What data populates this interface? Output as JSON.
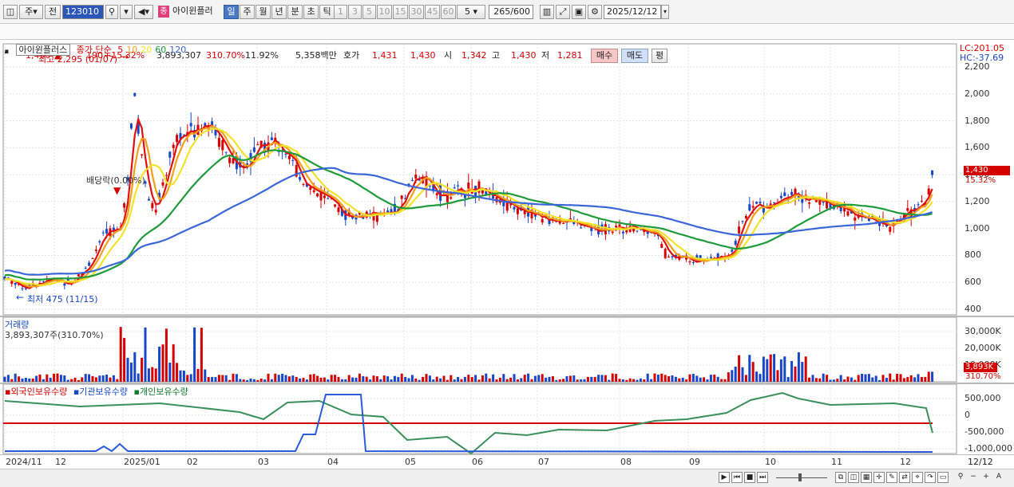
{
  "toolbar": {
    "type_label": "주",
    "prev_label": "전",
    "code": "123010",
    "name_badge": "종",
    "stock_name": "아이윈플러",
    "periods": [
      "일",
      "주",
      "월",
      "년",
      "분",
      "초",
      "틱"
    ],
    "selected_period": "일",
    "minutes": [
      "1",
      "3",
      "5",
      "10",
      "15",
      "30",
      "45",
      "60"
    ],
    "minute_value": "5",
    "count": "265",
    "count_max": "/600",
    "date": "2025/12/12"
  },
  "quote": {
    "price": "1,430",
    "change": "190",
    "change_pct": "+15.32%",
    "volume": "3,893,307",
    "vol_ratio": "310.70%",
    "turnover": "11.92%",
    "amount": "5,358백만",
    "hoga_label": "호가",
    "ask": "1,431",
    "bid": "1,430",
    "open_label": "시",
    "open": "1,342",
    "high_label": "고",
    "high": "1,430",
    "low_label": "저",
    "low": "1,281",
    "buy_label": "매수",
    "sell_label": "매도",
    "avg_label": "평"
  },
  "price_panel": {
    "stock_label": "아이윈플러스",
    "legend_prefix": "종가 단순",
    "ma": [
      {
        "period": "5",
        "color": "#e01010"
      },
      {
        "period": "10",
        "color": "#f2a01a"
      },
      {
        "period": "20",
        "color": "#f2e22a"
      },
      {
        "period": "60",
        "color": "#1e9a3a"
      },
      {
        "period": "120",
        "color": "#3a66d8"
      }
    ],
    "high_note": "최고 2,295 (01/07)",
    "low_note": "최저 475 (11/15)",
    "dividend_note": "배당락(0.00%)",
    "lc": "LC:201.05",
    "hc": "HC:-37.69",
    "y_ticks": [
      "2,200",
      "2,000",
      "1,800",
      "1,600",
      "1,400",
      "1,200",
      "1,000",
      "800",
      "600",
      "400"
    ],
    "current_price": "1,430",
    "current_pct": "15.32%"
  },
  "volume_panel": {
    "title": "거래량",
    "value": "3,893,307주(310.70%)",
    "y_ticks": [
      "30,000K",
      "20,000K",
      "10,000K"
    ],
    "current": "3,893K",
    "current_pct": "310.70%"
  },
  "holding_panel": {
    "series": [
      "외국인보유수량",
      "기관보유수량",
      "개인보유수량"
    ],
    "y_ticks": [
      "500,000",
      "0",
      "-500,000",
      "-1,000,000"
    ]
  },
  "x_axis": [
    "2024/11",
    "12",
    "2025/01",
    "02",
    "03",
    "04",
    "05",
    "06",
    "07",
    "08",
    "09",
    "10",
    "11",
    "12"
  ],
  "x_axis_right": "12/12",
  "colors": {
    "up": "#d40000",
    "down": "#1747c9",
    "highlight": "#4a78c2"
  },
  "chart_data": {
    "type": "line",
    "title": "",
    "ylim": [
      400,
      2300
    ],
    "x": [
      "2024/11",
      "12",
      "2025/01",
      "02",
      "03",
      "04",
      "05",
      "06",
      "07",
      "08",
      "09",
      "10",
      "11",
      "12/12"
    ],
    "series": [
      {
        "name": "5",
        "values": [
          560,
          720,
          1600,
          1800,
          1650,
          1150,
          1300,
          1250,
          1050,
          1000,
          800,
          1200,
          1100,
          1400
        ]
      },
      {
        "name": "10",
        "values": [
          570,
          700,
          1400,
          1750,
          1650,
          1180,
          1280,
          1240,
          1060,
          1000,
          810,
          1180,
          1110,
          1300
        ]
      },
      {
        "name": "20",
        "values": [
          580,
          650,
          1200,
          1650,
          1650,
          1200,
          1250,
          1230,
          1080,
          1000,
          820,
          1150,
          1120,
          1200
        ]
      },
      {
        "name": "60",
        "values": [
          780,
          720,
          850,
          1050,
          1400,
          1500,
          1300,
          1250,
          1150,
          1050,
          950,
          1000,
          1020,
          1100
        ]
      },
      {
        "name": "120",
        "values": [
          880,
          800,
          820,
          900,
          1000,
          1100,
          1200,
          1300,
          1280,
          1200,
          1080,
          1050,
          1050,
          1050
        ]
      }
    ]
  }
}
